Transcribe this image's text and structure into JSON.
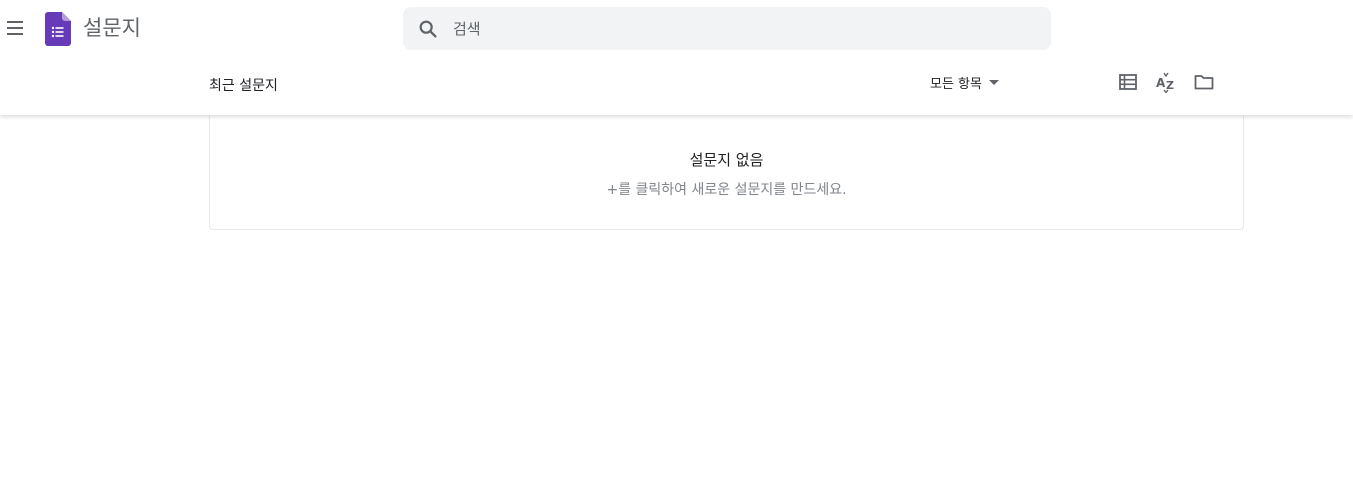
{
  "app": {
    "title": "설문지",
    "brand_color": "#673ab7"
  },
  "search": {
    "placeholder": "검색",
    "icon": "search-icon"
  },
  "header": {
    "section_title": "최근 설문지",
    "filter_label": "모든 항목",
    "tools": [
      "list-view-icon",
      "sort-az-icon",
      "folder-icon"
    ]
  },
  "empty_state": {
    "title": "설문지 없음",
    "subtitle": "+를 클릭하여 새로운 설문지를 만드세요."
  }
}
